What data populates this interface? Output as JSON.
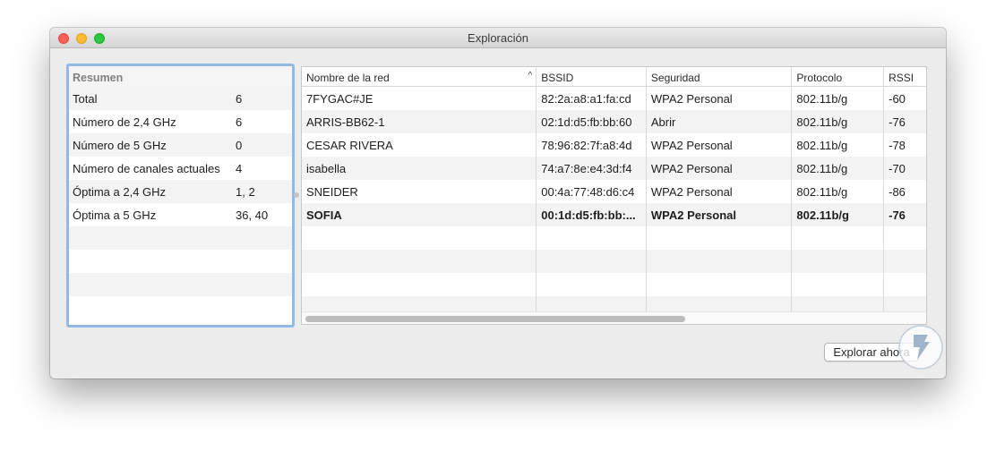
{
  "window": {
    "title": "Exploración"
  },
  "summary": {
    "header": "Resumen",
    "rows": [
      {
        "label": "Total",
        "value": "6"
      },
      {
        "label": "Número de 2,4 GHz",
        "value": "6"
      },
      {
        "label": "Número de 5 GHz",
        "value": "0"
      },
      {
        "label": "Número de canales actuales",
        "value": "4"
      },
      {
        "label": "Óptima a 2,4 GHz",
        "value": "1, 2"
      },
      {
        "label": "Óptima a 5 GHz",
        "value": "36, 40"
      },
      {
        "label": "",
        "value": ""
      },
      {
        "label": "",
        "value": ""
      },
      {
        "label": "",
        "value": ""
      },
      {
        "label": "",
        "value": ""
      }
    ]
  },
  "table": {
    "columns": [
      "Nombre de la red",
      "BSSID",
      "Seguridad",
      "Protocolo",
      "RSSI"
    ],
    "rows": [
      [
        "7FYGAC#JE",
        "82:2a:a8:a1:fa:cd",
        "WPA2 Personal",
        "802.11b/g",
        "-60"
      ],
      [
        "ARRIS-BB62-1",
        "02:1d:d5:fb:bb:60",
        "Abrir",
        "802.11b/g",
        "-76"
      ],
      [
        "CESAR RIVERA",
        "78:96:82:7f:a8:4d",
        "WPA2 Personal",
        "802.11b/g",
        "-78"
      ],
      [
        "isabella",
        "74:a7:8e:e4:3d:f4",
        "WPA2 Personal",
        "802.11b/g",
        "-70"
      ],
      [
        "SNEIDER",
        "00:4a:77:48:d6:c4",
        "WPA2 Personal",
        "802.11b/g",
        "-86"
      ],
      [
        "SOFIA",
        "00:1d:d5:fb:bb:...",
        "WPA2 Personal",
        "802.11b/g",
        "-76"
      ],
      [
        "",
        "",
        "",
        "",
        ""
      ],
      [
        "",
        "",
        "",
        "",
        ""
      ],
      [
        "",
        "",
        "",
        "",
        ""
      ],
      [
        "",
        "",
        "",
        "",
        ""
      ]
    ],
    "sort_icon": "chevron-up-icon"
  },
  "buttons": {
    "scan": "Explorar ahora"
  },
  "colors": {
    "close": "#fc5f57",
    "minimize": "#fdbc2e",
    "maximize": "#28c840",
    "focus_ring": "#92b8e3"
  }
}
